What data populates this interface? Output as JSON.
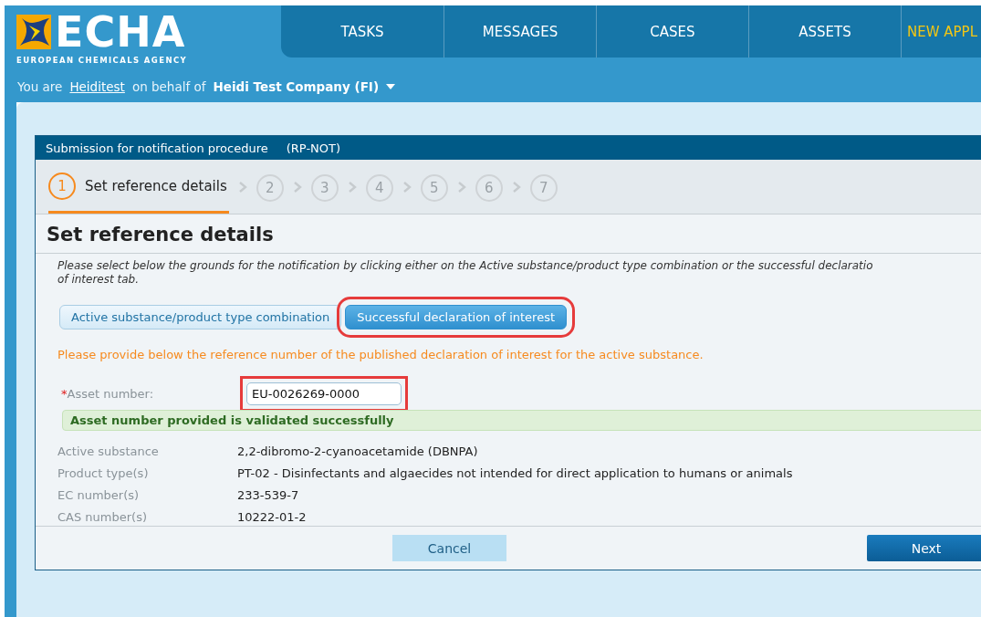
{
  "logo": {
    "wordmark": "ECHA",
    "subtitle": "EUROPEAN CHEMICALS AGENCY"
  },
  "nav": [
    {
      "label": "TASKS",
      "kind": "normal"
    },
    {
      "label": "MESSAGES",
      "kind": "normal"
    },
    {
      "label": "CASES",
      "kind": "normal"
    },
    {
      "label": "ASSETS",
      "kind": "normal"
    },
    {
      "label": "NEW APPL",
      "kind": "highlight"
    }
  ],
  "user_bar": {
    "prefix": "You are",
    "user": "Heiditest",
    "middle": "on behalf of",
    "company": "Heidi Test Company (FI)"
  },
  "panel": {
    "title": "Submission for notification procedure",
    "code": "(RP-NOT)"
  },
  "steps": [
    {
      "number": "1",
      "label": "Set reference details",
      "selected": true
    },
    {
      "number": "2",
      "selected": false
    },
    {
      "number": "3",
      "selected": false
    },
    {
      "number": "4",
      "selected": false
    },
    {
      "number": "5",
      "selected": false
    },
    {
      "number": "6",
      "selected": false
    },
    {
      "number": "7",
      "selected": false
    }
  ],
  "heading": "Set reference details",
  "instructions": [
    "Please select below the grounds for the notification by clicking either on the Active substance/product type combination or the successful declaratio",
    "of interest tab."
  ],
  "ground_tabs": [
    {
      "label": "Active substance/product type combination",
      "selected": false,
      "highlighted": false
    },
    {
      "label": "Successful declaration of interest",
      "selected": true,
      "highlighted": true
    }
  ],
  "notice": "Please provide below the reference number of the published declaration of interest for the active substance.",
  "asset_field": {
    "label": "Asset number:",
    "required_mark": "*",
    "value": "EU-0026269-0000",
    "highlighted": true
  },
  "validation": "Asset number provided is validated successfully",
  "details": [
    {
      "label": "Active substance",
      "value": "2,2-dibromo-2-cyanoacetamide (DBNPA)"
    },
    {
      "label": "Product type(s)",
      "value": "PT-02 - Disinfectants and algaecides not intended for direct application to humans or animals"
    },
    {
      "label": "EC number(s)",
      "value": "233-539-7"
    },
    {
      "label": "CAS number(s)",
      "value": "10222-01-2"
    }
  ],
  "buttons": [
    {
      "label": "Cancel",
      "kind": "secondary"
    },
    {
      "label": "Next",
      "kind": "primary"
    }
  ]
}
